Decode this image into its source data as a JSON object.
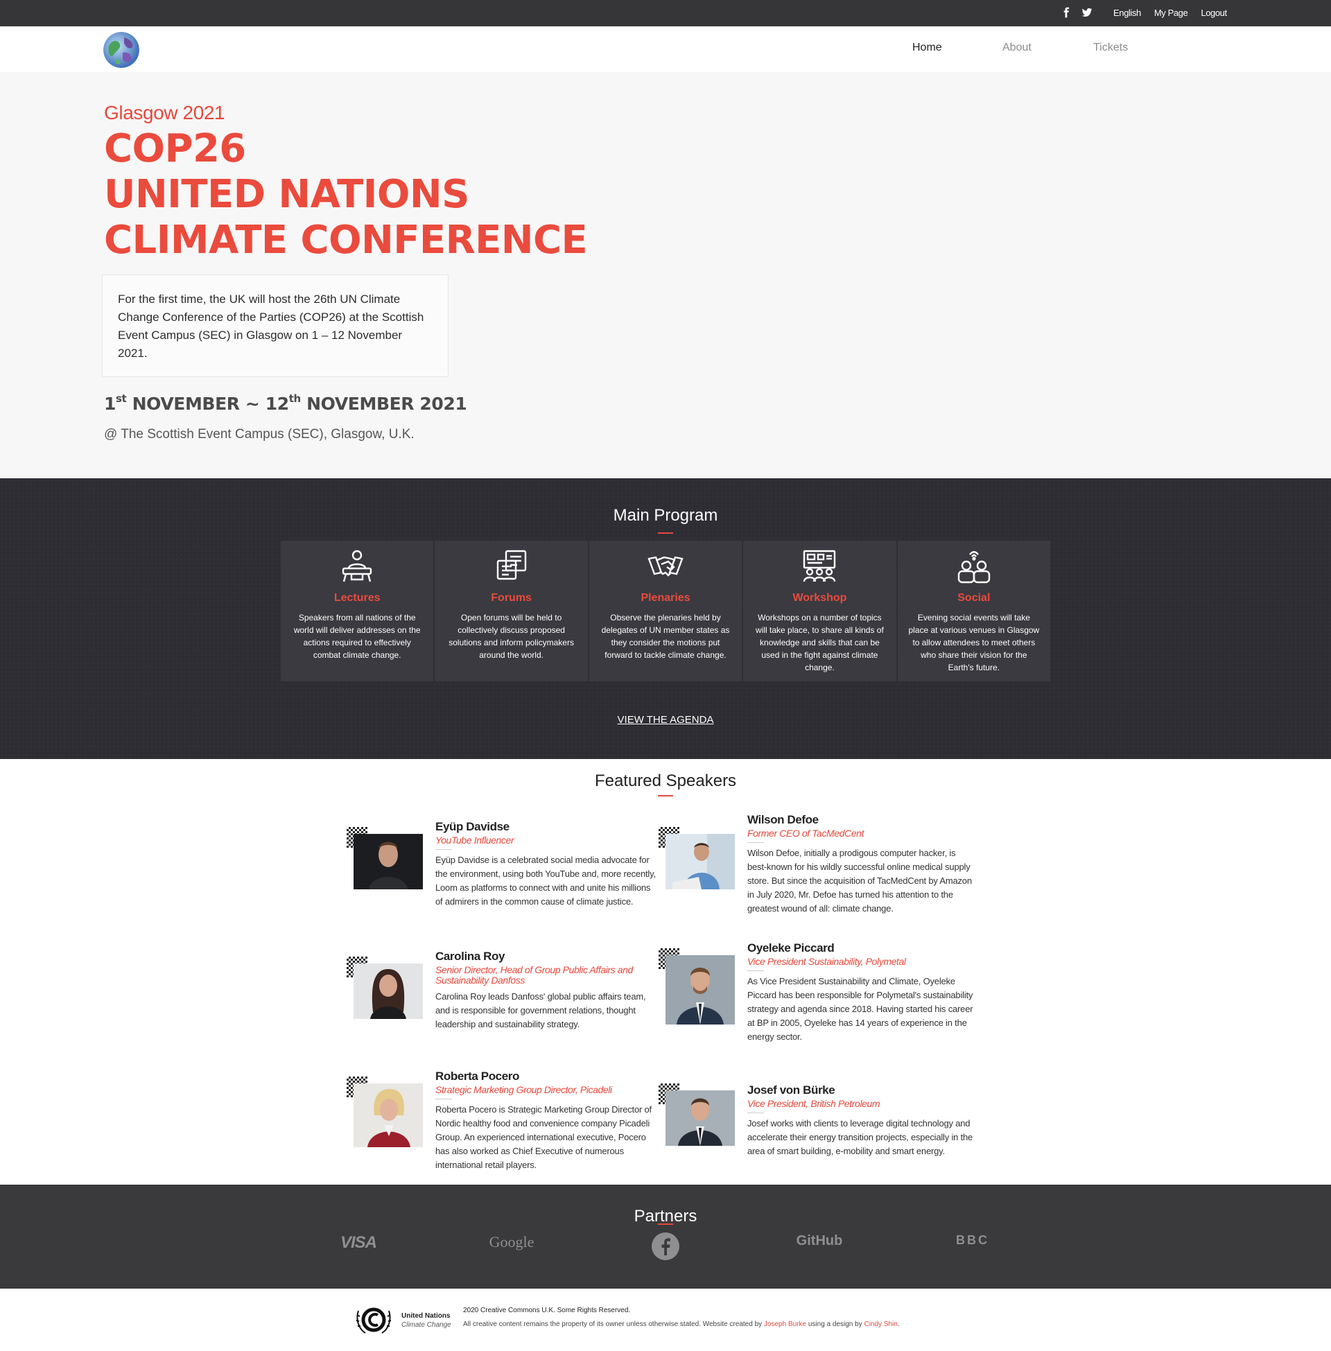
{
  "topbar": {
    "icons": [
      "facebook-icon",
      "twitter-icon"
    ],
    "language": "English",
    "my_page": "My Page",
    "logout": "Logout"
  },
  "nav": {
    "items": [
      "Home",
      "About",
      "Tickets"
    ],
    "active": "Home"
  },
  "hero": {
    "subtitle": "Glasgow 2021",
    "title_line1": "COP26",
    "title_line2": "UNITED NATIONS",
    "title_line3": "CLIMATE CONFERENCE",
    "intro": "For the first time, the UK will host the 26th UN Climate Change Conference of the Parties (COP26) at the Scottish Event Campus (SEC) in Glasgow on 1 – 12 November 2021.",
    "dates": {
      "start_day": "1",
      "start_suffix": "st",
      "start_month": "NOVEMBER ~ 12",
      "end_suffix": "th",
      "end_month": "NOVEMBER 2021"
    },
    "venue": "@ The Scottish Event Campus (SEC), Glasgow, U.K."
  },
  "program": {
    "title": "Main Program",
    "cards": [
      {
        "icon": "lecture-icon",
        "title": "Lectures",
        "text": "Speakers from all nations of the world will deliver addresses on the actions required to effectively combat climate change."
      },
      {
        "icon": "forum-icon",
        "title": "Forums",
        "text": "Open forums will be held to collectively discuss proposed solutions and inform policymakers around the world."
      },
      {
        "icon": "handshake-icon",
        "title": "Plenaries",
        "text": "Observe the plenaries held by delegates of UN member states as they consider the motions put forward to tackle climate change."
      },
      {
        "icon": "workshop-icon",
        "title": "Workshop",
        "text": "Workshops on a number of topics will take place, to share all kinds of knowledge and skills that can be used in the fight against climate change."
      },
      {
        "icon": "social-icon",
        "title": "Social",
        "text": "Evening social events will take place at various venues in Glasgow to allow attendees to meet others who share their vision for the Earth's future."
      }
    ],
    "agenda_link": "VIEW THE AGENDA"
  },
  "speakers": {
    "title": "Featured Speakers",
    "items": [
      {
        "name": "Eyüp Davidse",
        "role": "YouTube Influencer",
        "bio": "Eyüp Davidse is a celebrated social media advocate for the environment, using both YouTube and, more recently, Loom as platforms to connect with and unite his millions of admirers in the common cause of climate justice."
      },
      {
        "name": "Wilson Defoe",
        "role": "Former CEO of TacMedCent",
        "bio": "Wilson Defoe, initially a prodigous computer hacker, is best-known for his wildly successful online medical supply store. But since the acquisition of TacMedCent by Amazon in July 2020, Mr. Defoe has turned his attention to the greatest wound of all: climate change."
      },
      {
        "name": "Carolina Roy",
        "role": "Senior Director, Head of Group Public Affairs and Sustainability Danfoss",
        "bio": "Carolina Roy leads Danfoss' global public affairs team, and is responsible for government relations, thought leadership and sustainability strategy."
      },
      {
        "name": "Oyeleke Piccard",
        "role": "Vice President Sustainability, Polymetal",
        "bio": "As Vice President Sustainability and Climate, Oyeleke Piccard has been responsible for Polymetal's sustainability strategy and agenda since 2018. Having started his career at BP in 2005, Oyeleke has 14 years of experience in the energy sector."
      },
      {
        "name": "Roberta Pocero",
        "role": "Strategic Marketing Group Director, Picadeli",
        "bio": "Roberta Pocero is Strategic Marketing Group Director of Nordic healthy food and convenience company Picadeli Group. An experienced international executive, Pocero has also worked as Chief Executive of numerous international retail players."
      },
      {
        "name": "Josef von Bürke",
        "role": "Vice President, British Petroleum",
        "bio": "Josef works with clients to leverage digital technology and accelerate their energy transition projects, especially in the area of smart building, e-mobility and smart energy."
      }
    ]
  },
  "partners": {
    "title": "Partners",
    "logos": [
      "VISA",
      "Google",
      "facebook-logo",
      "GitHub",
      "BBC"
    ]
  },
  "footer": {
    "org_name": "United Nations",
    "org_sub": "Climate Change",
    "line1": "2020 Creative Commons U.K. Some Rights Reserved.",
    "line2_a": "All creative content remains the property of its owner unless otherwise stated. Website created by",
    "author": "Joseph Burke",
    "line2_b": "using a design by",
    "designer": "Cindy Shin",
    "line2_end": "."
  },
  "colors": {
    "accent": "#e8483c",
    "topbar": "#363638",
    "program_bg": "#2d2d33",
    "partners_bg": "#3a3a3c"
  }
}
